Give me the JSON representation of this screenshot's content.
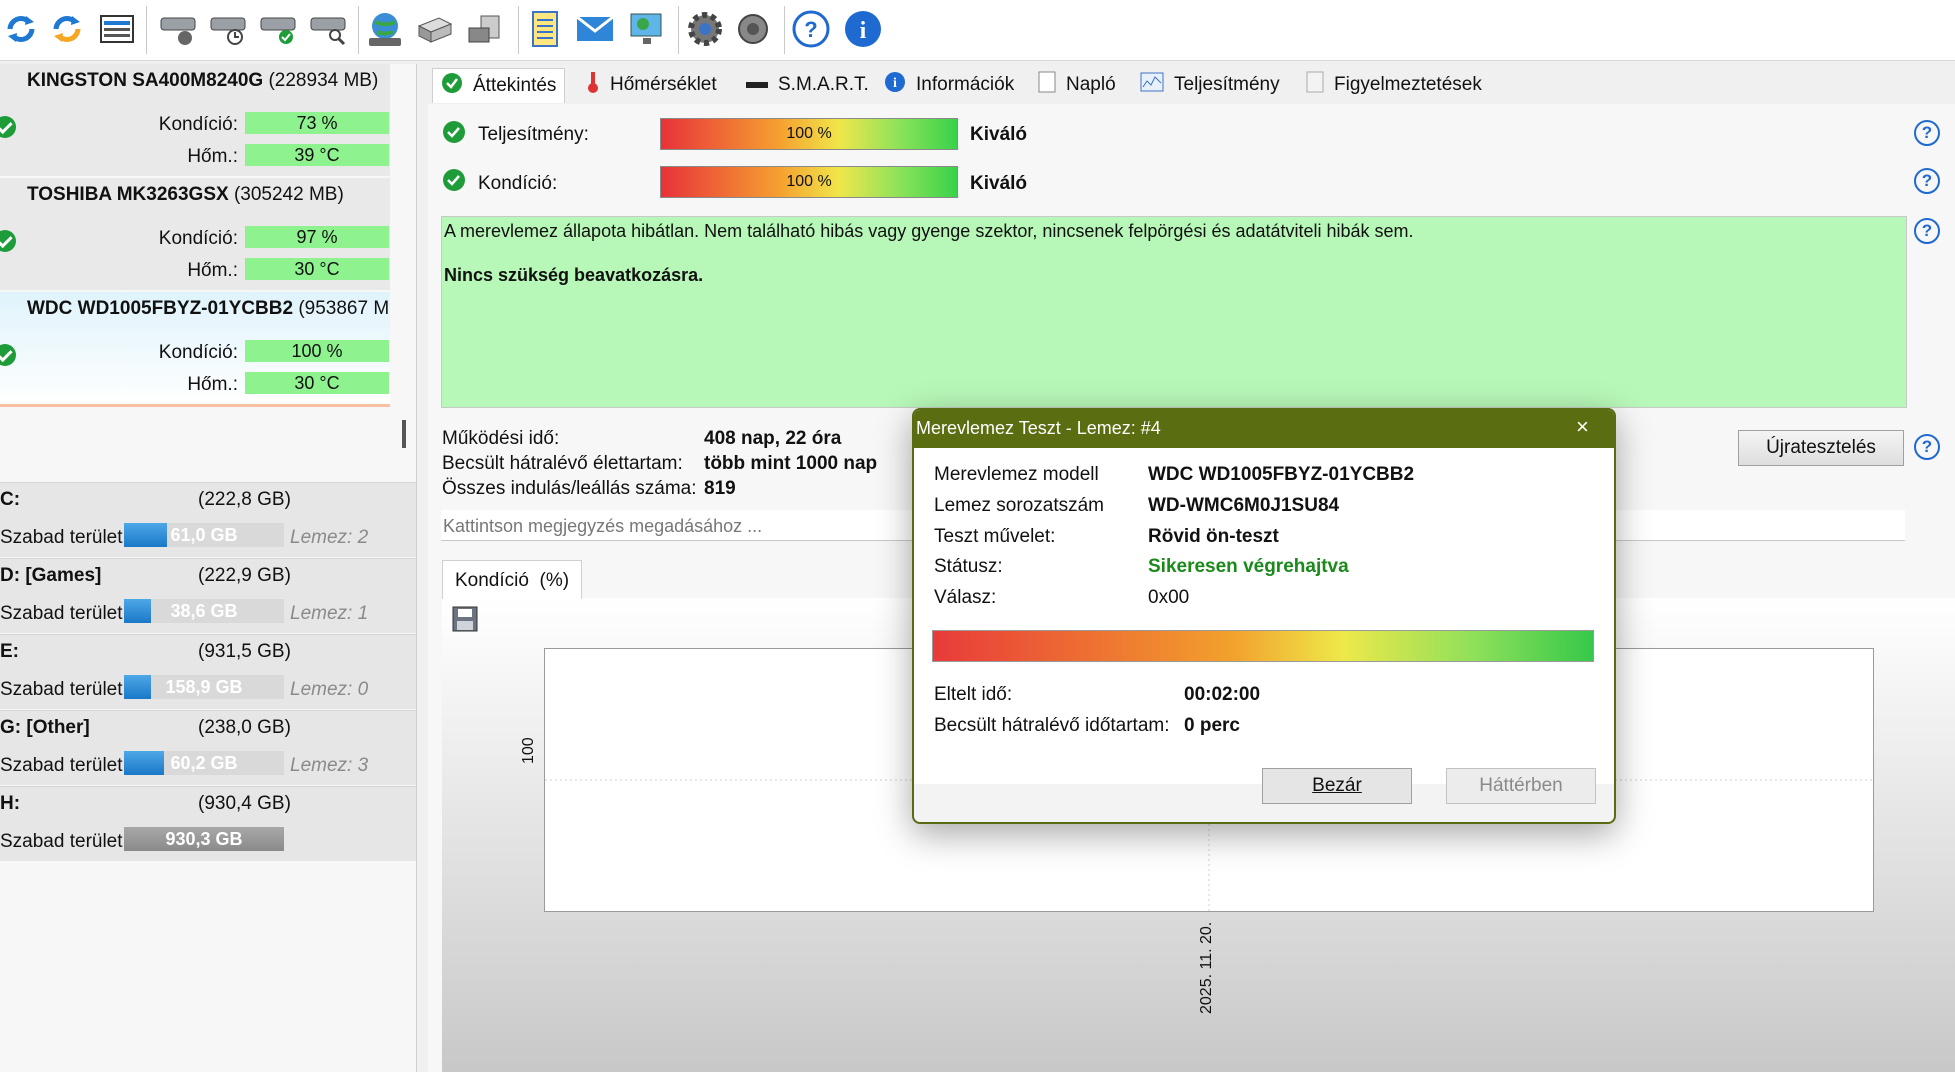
{
  "toolbar": {
    "icons": [
      "refresh-icon",
      "refresh-all-icon",
      "disk-list-icon",
      "hdd-icon",
      "hdd-timer-icon",
      "hdd-check-icon",
      "hdd-search-icon",
      "globe-disk-icon",
      "server-icon",
      "drive-icon",
      "notes-icon",
      "mail-icon",
      "monitor-icon",
      "settings-icon",
      "speaker-icon",
      "help-icon",
      "info-icon"
    ]
  },
  "disks": [
    {
      "model": "KINGSTON SA400M8240G",
      "size": "(228934 MB)",
      "condition_label": "Kondíció:",
      "condition": "73 %",
      "temp_label": "Hőm.:",
      "temp": "39 °C"
    },
    {
      "model": "TOSHIBA MK3263GSX",
      "size": "(305242 MB)",
      "condition_label": "Kondíció:",
      "condition": "97 %",
      "temp_label": "Hőm.:",
      "temp": "30 °C"
    },
    {
      "model": "WDC WD1005FBYZ-01YCBB2",
      "size": "(953867 M",
      "condition_label": "Kondíció:",
      "condition": "100 %",
      "temp_label": "Hőm.:",
      "temp": "30 °C"
    }
  ],
  "volumes": [
    {
      "letter": "C:",
      "size": "(222,8 GB)",
      "free_label": "Szabad terület",
      "free": "61,0 GB",
      "lemez": "Lemez: 2",
      "used_fraction": 0.27
    },
    {
      "letter": "D: [Games]",
      "size": "(222,9 GB)",
      "free_label": "Szabad terület",
      "free": "38,6 GB",
      "lemez": "Lemez: 1",
      "used_fraction": 0.17
    },
    {
      "letter": "E:",
      "size": "(931,5 GB)",
      "free_label": "Szabad terület",
      "free": "158,9 GB",
      "lemez": "Lemez: 0",
      "used_fraction": 0.17
    },
    {
      "letter": "G: [Other]",
      "size": "(238,0 GB)",
      "free_label": "Szabad terület",
      "free": "60,2 GB",
      "lemez": "Lemez: 3",
      "used_fraction": 0.25
    },
    {
      "letter": "H:",
      "size": "(930,4 GB)",
      "free_label": "Szabad terület",
      "free": "930,3 GB",
      "lemez": "",
      "used_fraction": 1.0
    }
  ],
  "tabs": [
    "Áttekintés",
    "Hőmérséklet",
    "S.M.A.R.T.",
    "Információk",
    "Napló",
    "Teljesítmény",
    "Figyelmeztetések"
  ],
  "overview": {
    "perf_label": "Teljesítmény:",
    "perf_value": "100 %",
    "perf_rating": "Kiváló",
    "cond_label": "Kondíció:",
    "cond_value": "100 %",
    "cond_rating": "Kiváló",
    "status_text": "A merevlemez állapota hibátlan. Nem található hibás vagy gyenge szektor, nincsenek felpörgési és adatátviteli hibák sem.",
    "status_action": "Nincs szükség beavatkozásra.",
    "uptime_label": "Működési idő:",
    "uptime": "408 nap, 22 óra",
    "lifetime_label": "Becsült hátralévő élettartam:",
    "lifetime": "több mint 1000 nap",
    "starts_label": "Összes indulás/leállás száma:",
    "starts": "819",
    "note_placeholder": "Kattintson megjegyzés megadásához ...",
    "retest_button": "Újratesztelés"
  },
  "chart_tab": "Kondíció  (%)",
  "chart_data": {
    "type": "line",
    "xlabel": "",
    "ylabel": "",
    "x_ticks": [
      "2025. 11. 20."
    ],
    "y_ticks": [
      "100"
    ],
    "series": [
      {
        "values": [
          100
        ]
      }
    ]
  },
  "dialog": {
    "title": "Merevlemez Teszt - Lemez: #4",
    "close": "×",
    "model_label": "Merevlemez modell",
    "model": "WDC WD1005FBYZ-01YCBB2",
    "serial_label": "Lemez sorozatszám",
    "serial": "WD-WMC6M0J1SU84",
    "op_label": "Teszt művelet:",
    "op": "Rövid ön-teszt",
    "status_label": "Státusz:",
    "status": "Sikeresen végrehajtva",
    "answer_label": "Válasz:",
    "answer": "0x00",
    "progress": 1.0,
    "elapsed_label": "Eltelt idő:",
    "elapsed": "00:02:00",
    "remaining_label": "Becsült hátralévő időtartam:",
    "remaining": "0 perc",
    "close_button": "Bezár",
    "background_button": "Háttérben",
    "status_color": "#1a8a1a"
  }
}
